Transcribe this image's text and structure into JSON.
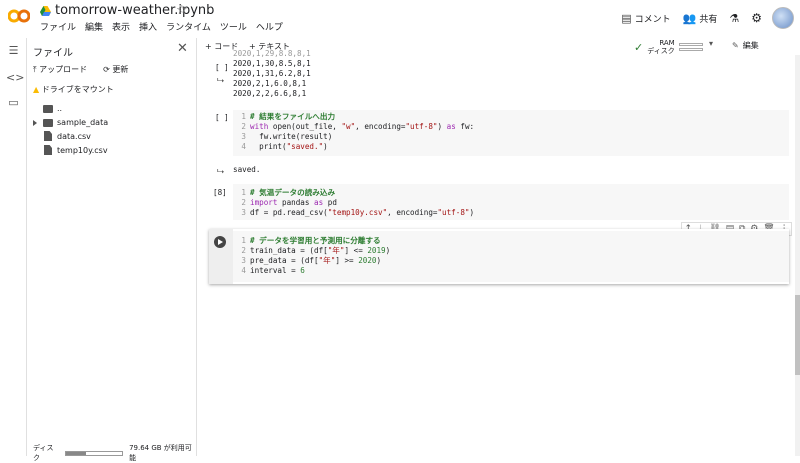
{
  "header": {
    "title": "tomorrow-weather.ipynb",
    "menu": [
      "ファイル",
      "編集",
      "表示",
      "挿入",
      "ランタイム",
      "ツール",
      "ヘルプ"
    ],
    "comment": "コメント",
    "share": "共有"
  },
  "files": {
    "title": "ファイル",
    "upload": "アップロード",
    "refresh": "更新",
    "mount": "ドライブをマウント",
    "tree": [
      "..",
      "sample_data",
      "data.csv",
      "temp10y.csv"
    ],
    "disk_label": "ディスク",
    "disk_free": "79.64 GB が利用可能",
    "disk_used_fraction": 0.35
  },
  "toolbar": {
    "code": "+ コード",
    "text": "+ テキスト",
    "ram": "RAM",
    "disk": "ディスク",
    "edit": "編集"
  },
  "cells": {
    "out1_bracket": "[ ]",
    "out1_lines": [
      "2020,1,30,8.5,8,1",
      "2020,1,31,6.2,8,1",
      "2020,2,1,6.0,8,1",
      "2020,2,2,6.6,8,1"
    ],
    "c2_bracket": "[ ]",
    "c2_comment": "# 結果をファイルへ出力",
    "c2_l2a": "with",
    "c2_l2b": " open(out_file, ",
    "c2_l2c": "\"w\"",
    "c2_l2d": ", encoding=",
    "c2_l2e": "\"utf-8\"",
    "c2_l2f": ") ",
    "c2_l2g": "as",
    "c2_l2h": " fw:",
    "c2_l3": "  fw.write(result)",
    "c2_l4a": "  print(",
    "c2_l4b": "\"saved.\"",
    "c2_l4c": ")",
    "c2_out": "saved.",
    "c3_bracket": "[8]",
    "c3_comment": "# 気温データの読み込み",
    "c3_l2a": "import",
    "c3_l2b": " pandas ",
    "c3_l2c": "as",
    "c3_l2d": " pd",
    "c3_l3a": "df = pd.read_csv(",
    "c3_l3b": "\"temp10y.csv\"",
    "c3_l3c": ", encoding=",
    "c3_l3d": "\"utf-8\"",
    "c3_l3e": ")",
    "c4_comment": "# データを学習用と予測用に分離する",
    "c4_l2a": "train_data = (df[",
    "c4_l2b": "\"年\"",
    "c4_l2c": "] <= ",
    "c4_l2d": "2019",
    "c4_l2e": ")",
    "c4_l3a": "pre_data = (df[",
    "c4_l3b": "\"年\"",
    "c4_l3c": "] >= ",
    "c4_l3d": "2020",
    "c4_l3e": ")",
    "c4_l4a": "interval = ",
    "c4_l4b": "6"
  }
}
